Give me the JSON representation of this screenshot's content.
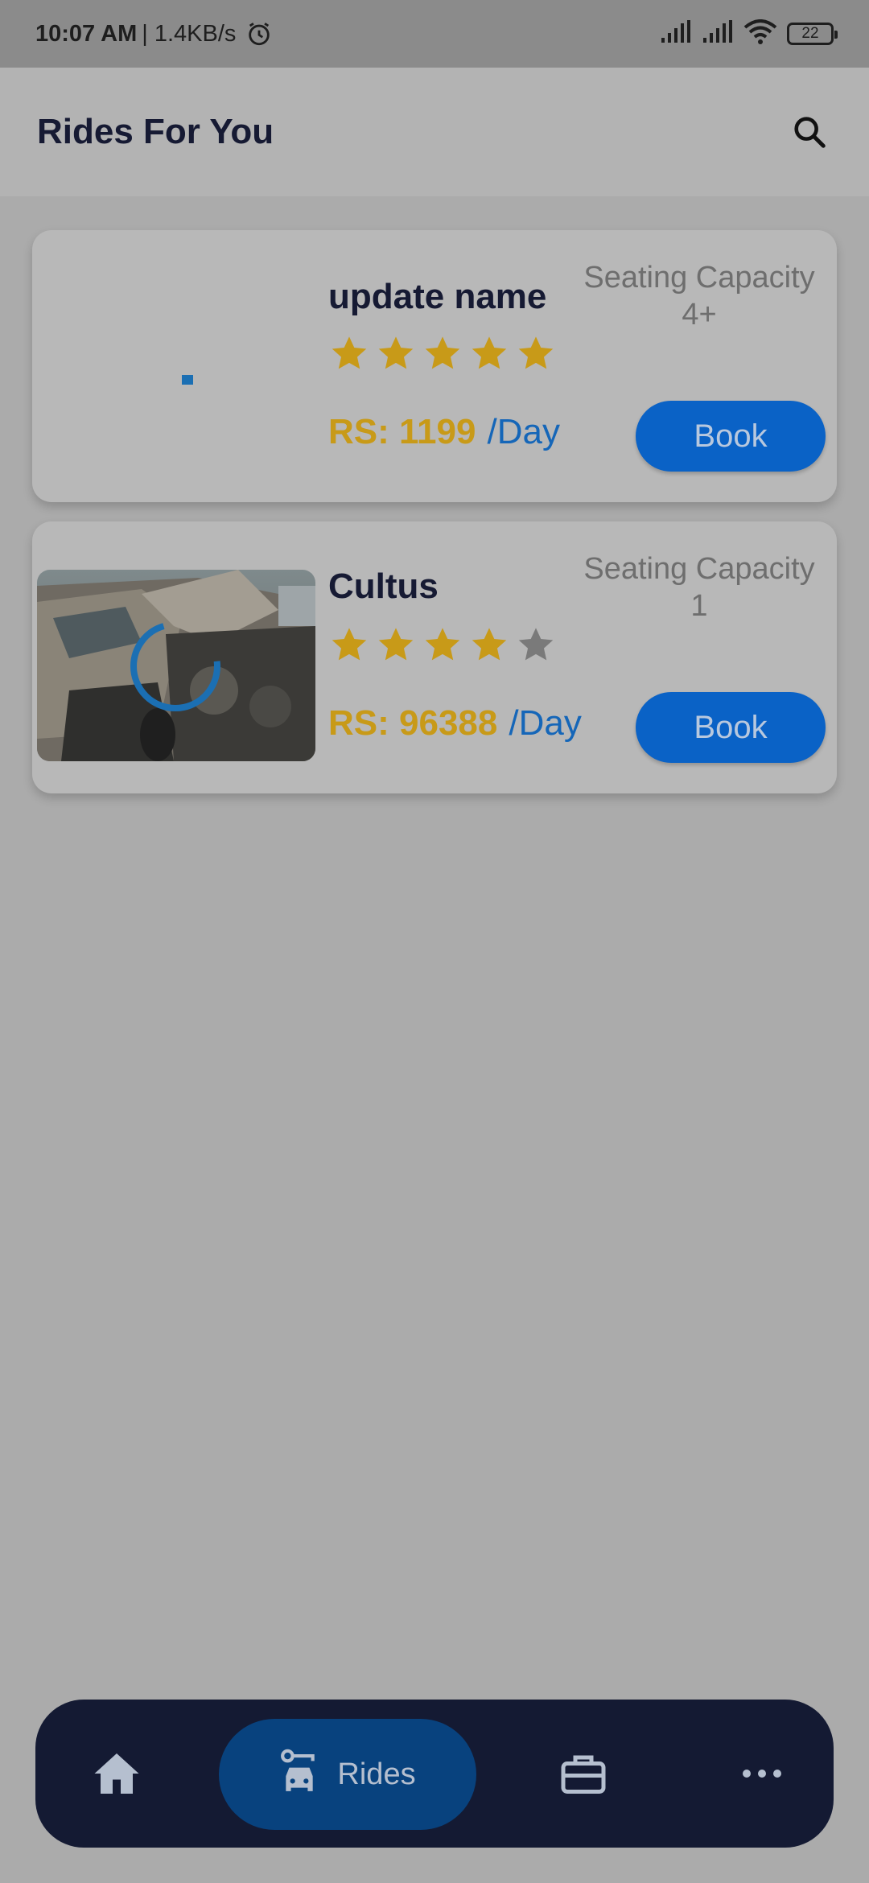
{
  "status_bar": {
    "time": "10:07 AM",
    "speed": "| 1.4KB/s",
    "battery": "22",
    "icons": [
      "alarm-icon",
      "signal-icon",
      "signal-icon",
      "wifi-icon",
      "battery-icon"
    ]
  },
  "header": {
    "title": "Rides For You",
    "search_icon": "search-icon"
  },
  "rides": [
    {
      "name": "update name",
      "rating": 5,
      "max_rating": 5,
      "price": "RS: 1199",
      "unit": "/Day",
      "seating_label": "Seating Capacity",
      "seating_value": "4+",
      "book_label": "Book",
      "image_state": "loading"
    },
    {
      "name": "Cultus",
      "rating": 4,
      "max_rating": 5,
      "price": "RS: 96388",
      "unit": "/Day",
      "seating_label": "Seating Capacity",
      "seating_value": "1",
      "book_label": "Book",
      "image_state": "loaded"
    }
  ],
  "bottom_nav": {
    "items": [
      {
        "icon": "home-icon",
        "label": ""
      },
      {
        "icon": "car-icon",
        "label": "Rides",
        "active": true
      },
      {
        "icon": "briefcase-icon",
        "label": ""
      },
      {
        "icon": "more-icon",
        "label": ""
      }
    ]
  },
  "colors": {
    "primary": "#0a62c6",
    "navy": "#141a33",
    "star": "#c89a18",
    "price": "#c89a18",
    "overlay_bg": "#ababab"
  }
}
